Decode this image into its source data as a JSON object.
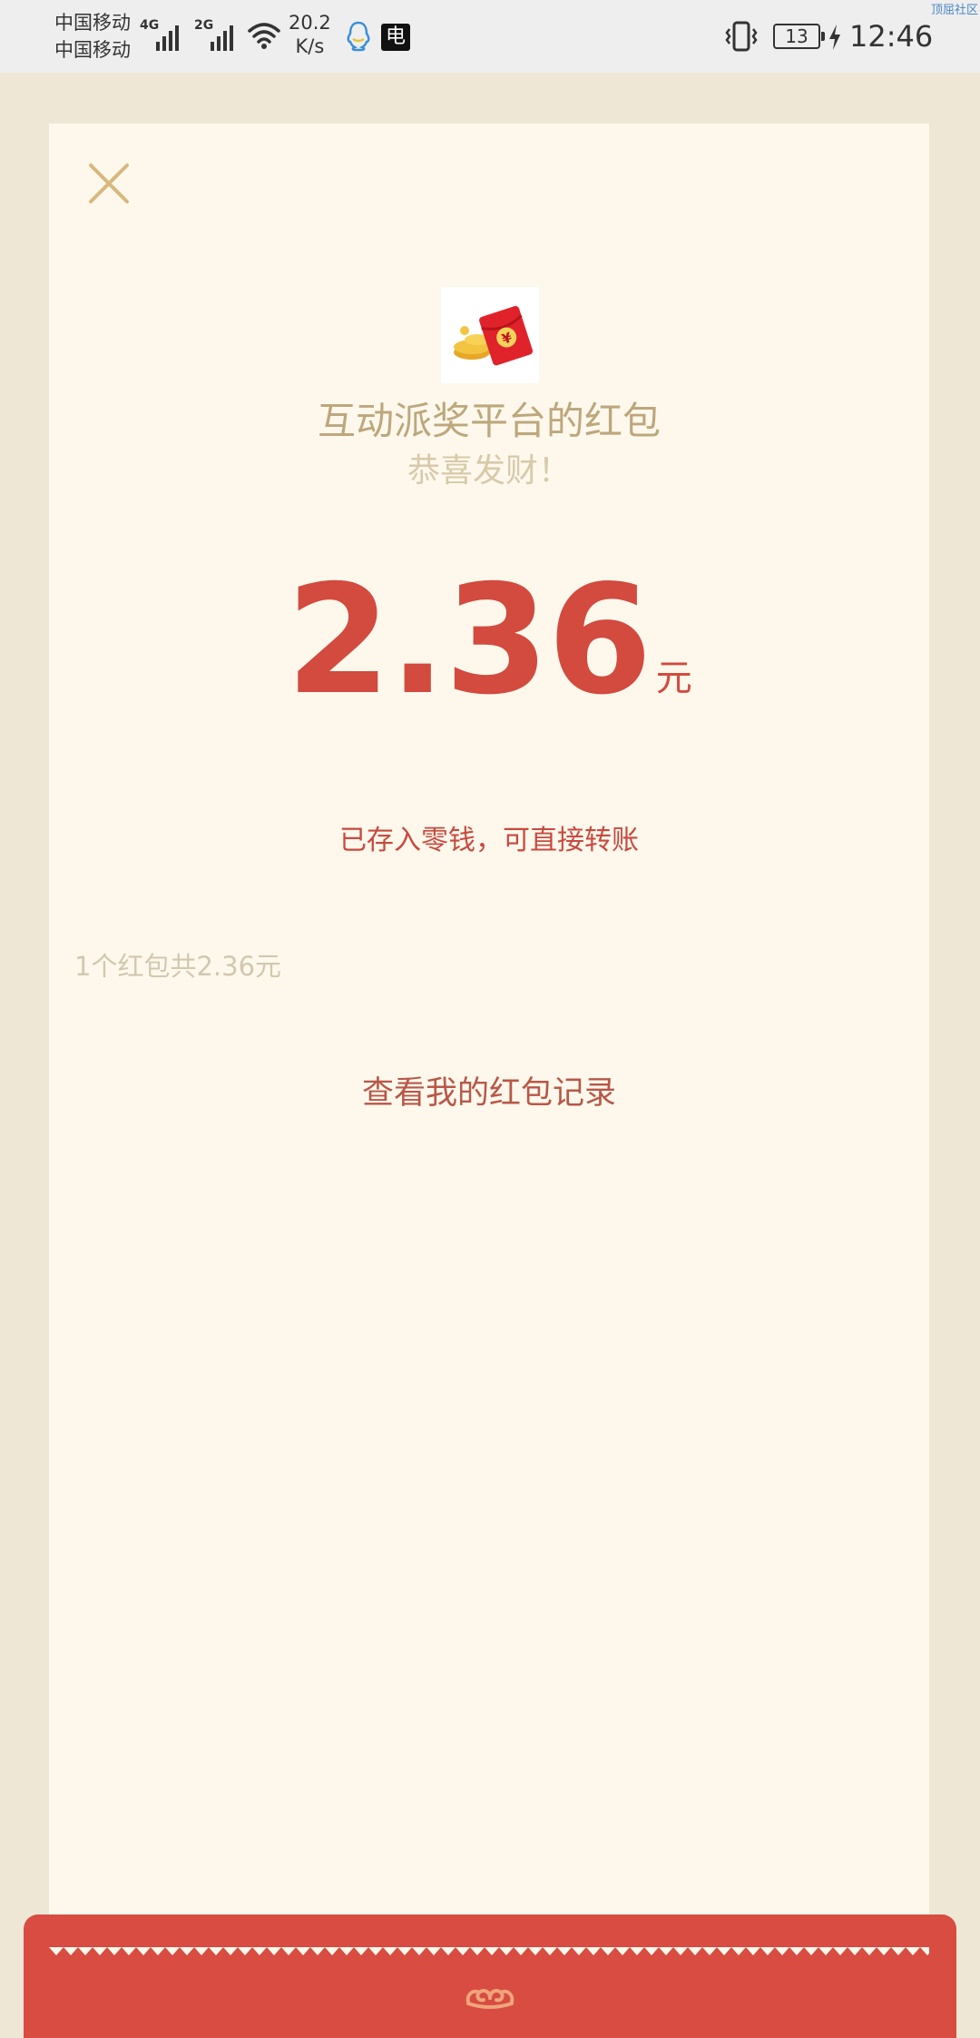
{
  "status_bar": {
    "carrier_1": "中国移动",
    "carrier_2": "中国移动",
    "signal_1_tag": "4G",
    "signal_2_tag": "2G",
    "speed_value": "20.2",
    "speed_unit": "K/s",
    "news_icon_glyph": "电",
    "battery_level": "13",
    "time": "12:46",
    "watermark": "顶屈社区"
  },
  "card": {
    "sender_name": "互动派奖平台的红包",
    "greeting": "恭喜发财！",
    "amount": "2.36",
    "unit": "元",
    "saved_note": "已存入零钱，可直接转账",
    "summary": "1个红包共2.36元",
    "records_link": "查看我的红包记录"
  },
  "colors": {
    "background": "#EEE7D6",
    "card": "#FEF8EC",
    "accent_red": "#D34A3E",
    "gold": "#BDA77C"
  }
}
